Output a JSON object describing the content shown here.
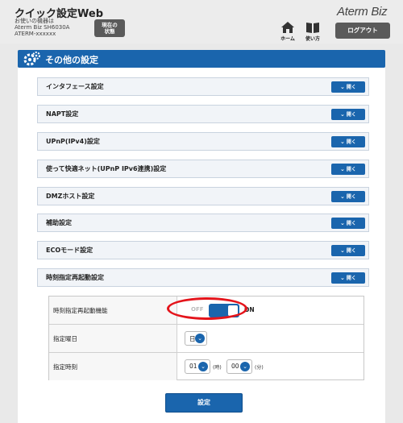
{
  "header": {
    "app_title": "クイック設定Web",
    "device_caption": "お使いの機器は",
    "device_model": "Aterm Biz SH6030A",
    "device_name": "ATERM-xxxxxx",
    "status_button": "現在の\n状態",
    "brand_logo": "Aterm Biz",
    "nav_home": "ホーム",
    "nav_help": "使い方",
    "logout_button": "ログアウト"
  },
  "section": {
    "title": "その他の設定"
  },
  "accordion": {
    "open_label": "開く",
    "items": [
      {
        "label": "インタフェース設定"
      },
      {
        "label": "NAPT設定"
      },
      {
        "label": "UPnP(IPv4)設定"
      },
      {
        "label": "使って快適ネット(UPnP IPv6連携)設定"
      },
      {
        "label": "DMZホスト設定"
      },
      {
        "label": "補助設定"
      },
      {
        "label": "ECOモード設定"
      },
      {
        "label": "時刻指定再起動設定"
      }
    ]
  },
  "reboot_settings": {
    "enable_label": "時刻指定再起動機能",
    "toggle_off": "OFF",
    "toggle_on": "ON",
    "toggle_state": "ON",
    "day_label": "指定曜日",
    "day_value": "日",
    "time_label": "指定時刻",
    "hour_value": "01",
    "hour_unit": "(時)",
    "minute_value": "00",
    "minute_unit": "(分)"
  },
  "submit_button": "設定",
  "colors": {
    "accent": "#1a65ad",
    "highlight": "#e4141b",
    "background": "#e9e9e9"
  }
}
